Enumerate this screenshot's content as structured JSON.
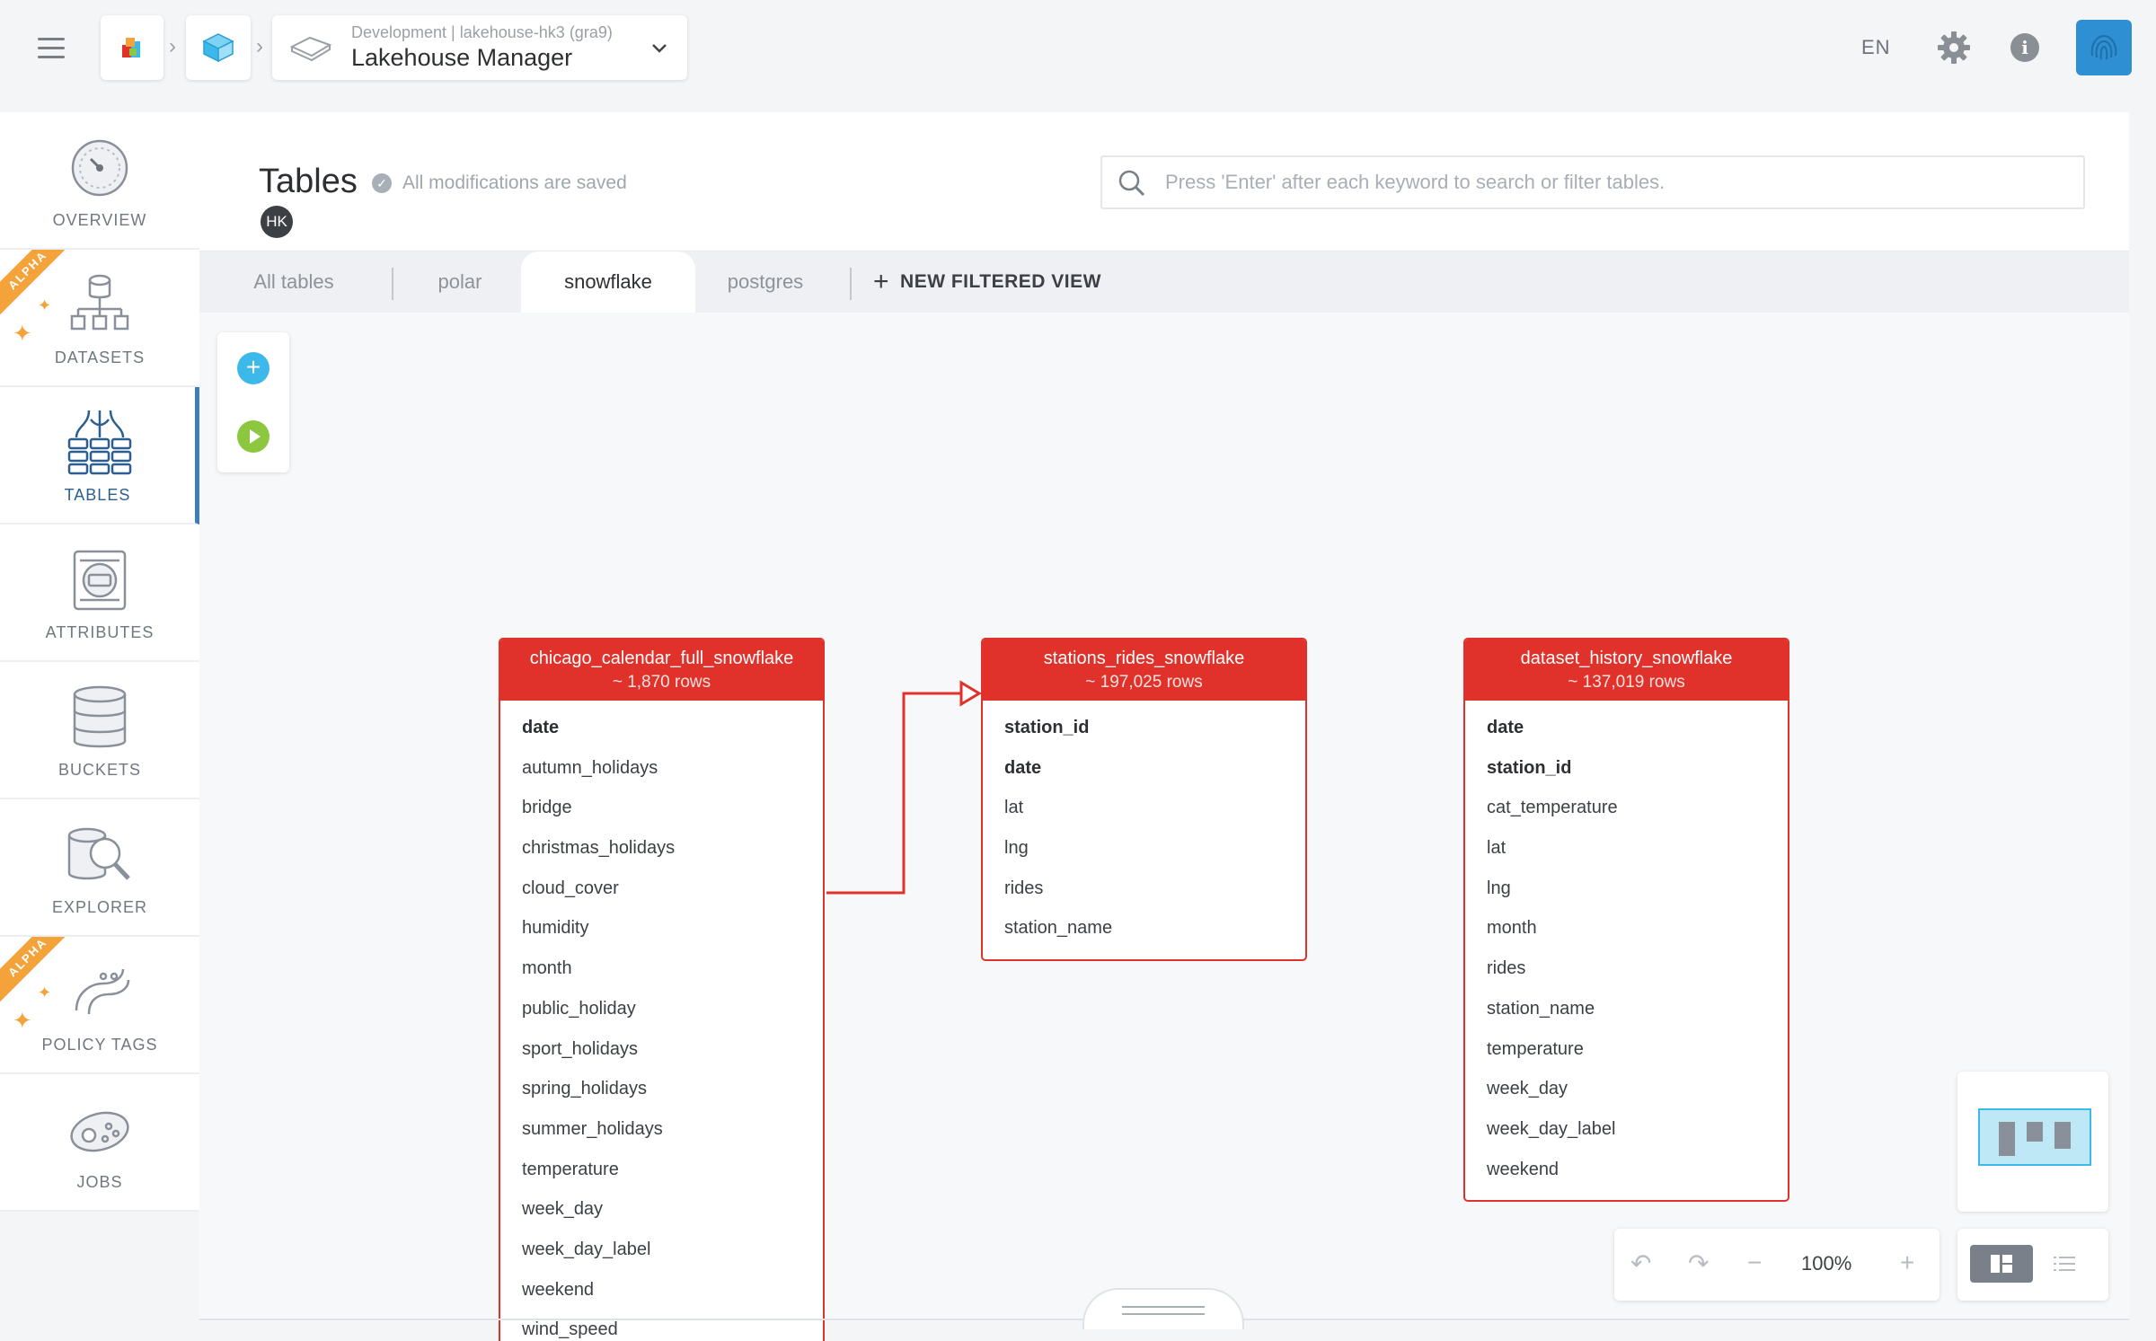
{
  "breadcrumb": {
    "subtitle": "Development | lakehouse-hk3 (gra9)",
    "title": "Lakehouse Manager"
  },
  "topbar": {
    "language": "EN"
  },
  "sidebar": {
    "items": [
      {
        "label": "OVERVIEW"
      },
      {
        "label": "DATASETS",
        "badge": "ALPHA"
      },
      {
        "label": "TABLES"
      },
      {
        "label": "ATTRIBUTES"
      },
      {
        "label": "BUCKETS"
      },
      {
        "label": "EXPLORER"
      },
      {
        "label": "POLICY TAGS",
        "badge": "ALPHA"
      },
      {
        "label": "JOBS"
      }
    ]
  },
  "header": {
    "title": "Tables",
    "saved_status": "All modifications are saved",
    "user_initials": "HK",
    "search_placeholder": "Press 'Enter' after each keyword to search or filter tables."
  },
  "tabs": [
    {
      "label": "All tables"
    },
    {
      "label": "polar"
    },
    {
      "label": "snowflake"
    },
    {
      "label": "postgres"
    }
  ],
  "new_view_label": "NEW FILTERED VIEW",
  "tables": [
    {
      "name": "chicago_calendar_full_snowflake",
      "rows": "~ 1,870 rows",
      "columns": [
        "date",
        "autumn_holidays",
        "bridge",
        "christmas_holidays",
        "cloud_cover",
        "humidity",
        "month",
        "public_holiday",
        "sport_holidays",
        "spring_holidays",
        "summer_holidays",
        "temperature",
        "week_day",
        "week_day_label",
        "weekend",
        "wind_speed"
      ]
    },
    {
      "name": "stations_rides_snowflake",
      "rows": "~ 197,025 rows",
      "columns": [
        "station_id",
        "date",
        "lat",
        "lng",
        "rides",
        "station_name"
      ]
    },
    {
      "name": "dataset_history_snowflake",
      "rows": "~ 137,019 rows",
      "columns": [
        "date",
        "station_id",
        "cat_temperature",
        "lat",
        "lng",
        "month",
        "rides",
        "station_name",
        "temperature",
        "week_day",
        "week_day_label",
        "weekend"
      ]
    }
  ],
  "zoom": {
    "level": "100%"
  },
  "colors": {
    "accent": "#e0322b",
    "active_nav": "#3b7fb8",
    "add": "#3db8ea",
    "run": "#8dc63f"
  }
}
